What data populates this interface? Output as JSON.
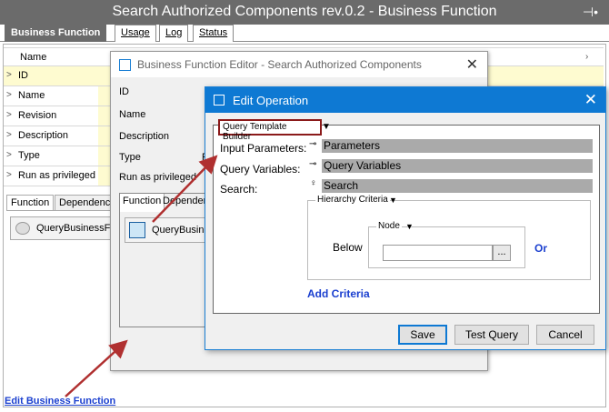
{
  "window": {
    "title": "Search Authorized Components rev.0.2 - Business Function",
    "pin_glyph": "⊣•"
  },
  "tabs": [
    "Business Function",
    "Usage",
    "Log",
    "Status"
  ],
  "properties": {
    "header": "Name",
    "rows": [
      "ID",
      "Name",
      "Revision",
      "Description",
      "Type",
      "Run as privileged"
    ]
  },
  "subtabs": [
    "Function",
    "Dependenci"
  ],
  "function_item": "QueryBusinessFu",
  "edit_link": "Edit Business Function",
  "bfe": {
    "title": "Business Function Editor - Search Authorized Components",
    "labels": [
      "ID",
      "Name",
      "Description",
      "Type",
      "Run as privileged"
    ],
    "type_value": "F",
    "subtabs": [
      "Function",
      "Depender"
    ],
    "function_item": "QueryBusine"
  },
  "eo": {
    "title": "Edit Operation",
    "builder_label": "Query Template Builder",
    "input_parameters_label": "Input Parameters:",
    "query_variables_label": "Query Variables:",
    "search_label": "Search:",
    "parameters_bar": "Parameters",
    "query_variables_bar": "Query Variables",
    "search_bar": "Search",
    "hierarchy_label": "Hierarchy Criteria",
    "below_label": "Below",
    "node_label": "Node",
    "node_value": "",
    "browse_label": "...",
    "or_label": "Or",
    "add_criteria": "Add Criteria",
    "save": "Save",
    "test_query": "Test Query",
    "cancel": "Cancel"
  },
  "colors": {
    "accent": "#0e79d3",
    "highlight": "#8b1a1a",
    "arrow": "#b03030",
    "value_bg": "#fefbd0"
  }
}
